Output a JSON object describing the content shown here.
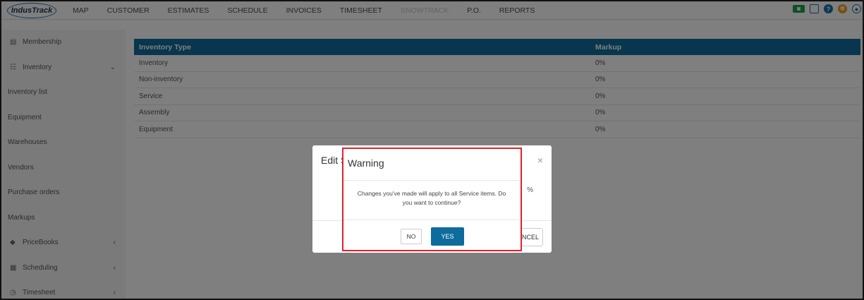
{
  "app": {
    "logo_text": "IndusTrack"
  },
  "nav": {
    "items": [
      "MAP",
      "CUSTOMER",
      "ESTIMATES",
      "SCHEDULE",
      "INVOICES",
      "TIMESHEET",
      "SNOWTRACK",
      "P.O.",
      "REPORTS"
    ],
    "icons": [
      "chat-badge-icon",
      "message-icon",
      "help-icon",
      "settings-icon",
      "user-icon"
    ],
    "colors": {
      "badge": "#1e9e4a",
      "help": "#1f6fb0",
      "settings": "#f29a1f",
      "user": "#1f6fb0"
    }
  },
  "sidebar": {
    "items": [
      {
        "label": "Membership",
        "icon": "membership-icon"
      },
      {
        "label": "Inventory",
        "icon": "inventory-icon",
        "chevron": "⌄"
      },
      {
        "label": "Inventory list"
      },
      {
        "label": "Equipment"
      },
      {
        "label": "Warehouses"
      },
      {
        "label": "Vendors"
      },
      {
        "label": "Purchase orders"
      },
      {
        "label": "Markups"
      },
      {
        "label": "PriceBooks",
        "icon": "tag-icon",
        "chevron": "‹"
      },
      {
        "label": "Scheduling",
        "icon": "calendar-icon",
        "chevron": "‹"
      },
      {
        "label": "Timesheet",
        "icon": "clock-icon",
        "chevron": "‹"
      }
    ]
  },
  "table": {
    "headers": [
      "Inventory Type",
      "Markup"
    ],
    "rows": [
      [
        "Inventory",
        "0%"
      ],
      [
        "Non-inventory",
        "0%"
      ],
      [
        "Service",
        "0%"
      ],
      [
        "Assembly",
        "0%"
      ],
      [
        "Equipment",
        "0%"
      ]
    ]
  },
  "edit_modal": {
    "title": "Edit S",
    "close": "×",
    "percent": "%",
    "cancel_label": "CANCEL"
  },
  "warning_modal": {
    "title": "Warning",
    "message": "Changes you've made will apply to all Service items. Do you want to continue?",
    "no_label": "NO",
    "yes_label": "YES",
    "highlight_color": "#e3202a"
  }
}
